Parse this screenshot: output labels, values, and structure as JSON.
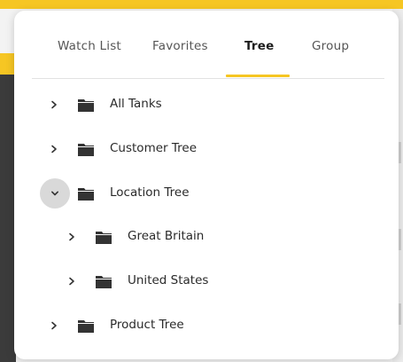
{
  "tabs": [
    {
      "label": "Watch List",
      "active": false
    },
    {
      "label": "Favorites",
      "active": false
    },
    {
      "label": "Tree",
      "active": true
    },
    {
      "label": "Group",
      "active": false
    }
  ],
  "tree": [
    {
      "label": "All Tanks",
      "level": 0,
      "expanded": false
    },
    {
      "label": "Customer Tree",
      "level": 0,
      "expanded": false
    },
    {
      "label": "Location Tree",
      "level": 0,
      "expanded": true
    },
    {
      "label": "Great Britain",
      "level": 1,
      "expanded": false
    },
    {
      "label": "United States",
      "level": 1,
      "expanded": false
    },
    {
      "label": "Product Tree",
      "level": 0,
      "expanded": false
    }
  ],
  "colors": {
    "accent": "#f6c623",
    "text": "#2a2a2a",
    "tab_inactive": "#555555",
    "expanded_chevron_bg": "#d9d9d9"
  }
}
